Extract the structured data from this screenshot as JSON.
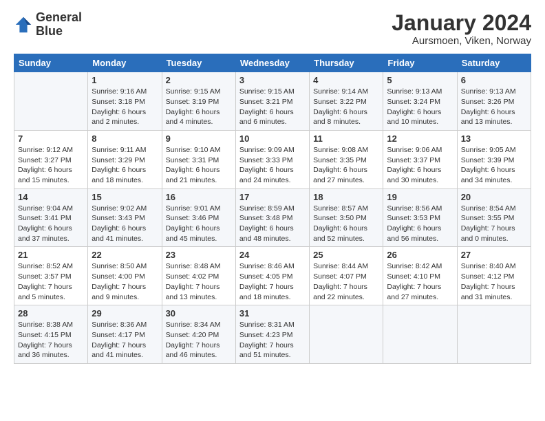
{
  "header": {
    "logo_line1": "General",
    "logo_line2": "Blue",
    "month": "January 2024",
    "location": "Aursmoen, Viken, Norway"
  },
  "weekdays": [
    "Sunday",
    "Monday",
    "Tuesday",
    "Wednesday",
    "Thursday",
    "Friday",
    "Saturday"
  ],
  "weeks": [
    [
      {
        "day": "",
        "info": ""
      },
      {
        "day": "1",
        "info": "Sunrise: 9:16 AM\nSunset: 3:18 PM\nDaylight: 6 hours\nand 2 minutes."
      },
      {
        "day": "2",
        "info": "Sunrise: 9:15 AM\nSunset: 3:19 PM\nDaylight: 6 hours\nand 4 minutes."
      },
      {
        "day": "3",
        "info": "Sunrise: 9:15 AM\nSunset: 3:21 PM\nDaylight: 6 hours\nand 6 minutes."
      },
      {
        "day": "4",
        "info": "Sunrise: 9:14 AM\nSunset: 3:22 PM\nDaylight: 6 hours\nand 8 minutes."
      },
      {
        "day": "5",
        "info": "Sunrise: 9:13 AM\nSunset: 3:24 PM\nDaylight: 6 hours\nand 10 minutes."
      },
      {
        "day": "6",
        "info": "Sunrise: 9:13 AM\nSunset: 3:26 PM\nDaylight: 6 hours\nand 13 minutes."
      }
    ],
    [
      {
        "day": "7",
        "info": "Sunrise: 9:12 AM\nSunset: 3:27 PM\nDaylight: 6 hours\nand 15 minutes."
      },
      {
        "day": "8",
        "info": "Sunrise: 9:11 AM\nSunset: 3:29 PM\nDaylight: 6 hours\nand 18 minutes."
      },
      {
        "day": "9",
        "info": "Sunrise: 9:10 AM\nSunset: 3:31 PM\nDaylight: 6 hours\nand 21 minutes."
      },
      {
        "day": "10",
        "info": "Sunrise: 9:09 AM\nSunset: 3:33 PM\nDaylight: 6 hours\nand 24 minutes."
      },
      {
        "day": "11",
        "info": "Sunrise: 9:08 AM\nSunset: 3:35 PM\nDaylight: 6 hours\nand 27 minutes."
      },
      {
        "day": "12",
        "info": "Sunrise: 9:06 AM\nSunset: 3:37 PM\nDaylight: 6 hours\nand 30 minutes."
      },
      {
        "day": "13",
        "info": "Sunrise: 9:05 AM\nSunset: 3:39 PM\nDaylight: 6 hours\nand 34 minutes."
      }
    ],
    [
      {
        "day": "14",
        "info": "Sunrise: 9:04 AM\nSunset: 3:41 PM\nDaylight: 6 hours\nand 37 minutes."
      },
      {
        "day": "15",
        "info": "Sunrise: 9:02 AM\nSunset: 3:43 PM\nDaylight: 6 hours\nand 41 minutes."
      },
      {
        "day": "16",
        "info": "Sunrise: 9:01 AM\nSunset: 3:46 PM\nDaylight: 6 hours\nand 45 minutes."
      },
      {
        "day": "17",
        "info": "Sunrise: 8:59 AM\nSunset: 3:48 PM\nDaylight: 6 hours\nand 48 minutes."
      },
      {
        "day": "18",
        "info": "Sunrise: 8:57 AM\nSunset: 3:50 PM\nDaylight: 6 hours\nand 52 minutes."
      },
      {
        "day": "19",
        "info": "Sunrise: 8:56 AM\nSunset: 3:53 PM\nDaylight: 6 hours\nand 56 minutes."
      },
      {
        "day": "20",
        "info": "Sunrise: 8:54 AM\nSunset: 3:55 PM\nDaylight: 7 hours\nand 0 minutes."
      }
    ],
    [
      {
        "day": "21",
        "info": "Sunrise: 8:52 AM\nSunset: 3:57 PM\nDaylight: 7 hours\nand 5 minutes."
      },
      {
        "day": "22",
        "info": "Sunrise: 8:50 AM\nSunset: 4:00 PM\nDaylight: 7 hours\nand 9 minutes."
      },
      {
        "day": "23",
        "info": "Sunrise: 8:48 AM\nSunset: 4:02 PM\nDaylight: 7 hours\nand 13 minutes."
      },
      {
        "day": "24",
        "info": "Sunrise: 8:46 AM\nSunset: 4:05 PM\nDaylight: 7 hours\nand 18 minutes."
      },
      {
        "day": "25",
        "info": "Sunrise: 8:44 AM\nSunset: 4:07 PM\nDaylight: 7 hours\nand 22 minutes."
      },
      {
        "day": "26",
        "info": "Sunrise: 8:42 AM\nSunset: 4:10 PM\nDaylight: 7 hours\nand 27 minutes."
      },
      {
        "day": "27",
        "info": "Sunrise: 8:40 AM\nSunset: 4:12 PM\nDaylight: 7 hours\nand 31 minutes."
      }
    ],
    [
      {
        "day": "28",
        "info": "Sunrise: 8:38 AM\nSunset: 4:15 PM\nDaylight: 7 hours\nand 36 minutes."
      },
      {
        "day": "29",
        "info": "Sunrise: 8:36 AM\nSunset: 4:17 PM\nDaylight: 7 hours\nand 41 minutes."
      },
      {
        "day": "30",
        "info": "Sunrise: 8:34 AM\nSunset: 4:20 PM\nDaylight: 7 hours\nand 46 minutes."
      },
      {
        "day": "31",
        "info": "Sunrise: 8:31 AM\nSunset: 4:23 PM\nDaylight: 7 hours\nand 51 minutes."
      },
      {
        "day": "",
        "info": ""
      },
      {
        "day": "",
        "info": ""
      },
      {
        "day": "",
        "info": ""
      }
    ]
  ]
}
